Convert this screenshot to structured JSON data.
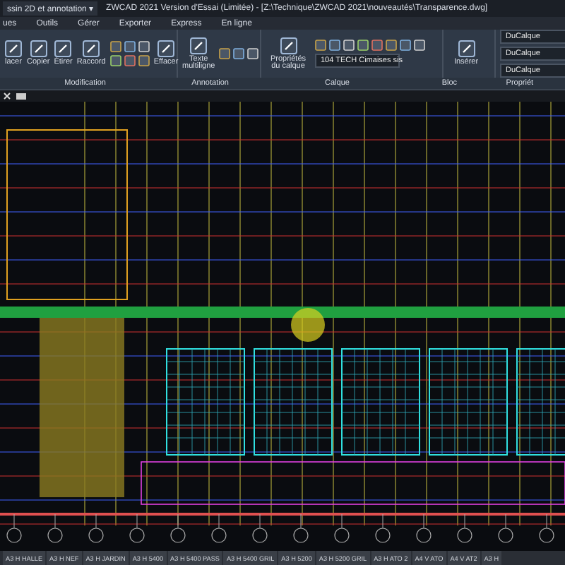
{
  "window": {
    "workspace": "ssin 2D et annotation",
    "workspace_caret": "▾",
    "title": "ZWCAD 2021 Version d'Essai (Limitée) - [Z:\\Technique\\ZWCAD 2021\\nouveautés\\Transparence.dwg]"
  },
  "menu": [
    {
      "label": "ues",
      "selected": false
    },
    {
      "label": "Outils",
      "selected": false
    },
    {
      "label": "Gérer",
      "selected": false
    },
    {
      "label": "Exporter",
      "selected": false
    },
    {
      "label": "Express",
      "selected": false
    },
    {
      "label": "En ligne",
      "selected": false
    }
  ],
  "ribbon": {
    "panels": [
      {
        "label": "Modification",
        "buttons": [
          {
            "label": "lacer"
          },
          {
            "label": "Copier"
          },
          {
            "label": "Étirer"
          },
          {
            "label": "Raccord"
          },
          {
            "label": "Effacer"
          }
        ]
      },
      {
        "label": "Annotation",
        "buttons": [
          {
            "label": "Texte multiligne"
          }
        ]
      },
      {
        "label": "Calque",
        "buttons": [
          {
            "label": "Propriétés du calque"
          }
        ],
        "layer": "104 TECH Cimaises sis"
      },
      {
        "label": "Bloc",
        "buttons": [
          {
            "label": "Insérer"
          }
        ]
      },
      {
        "label": "Propriét",
        "dropdowns": [
          "DuCalque",
          "DuCalque",
          "DuCalque"
        ]
      }
    ]
  },
  "layout_tabs": [
    {
      "label": "A3 H HALLE",
      "selected": false
    },
    {
      "label": "A3 H NEF",
      "selected": false
    },
    {
      "label": "A3 H JARDIN",
      "selected": false
    },
    {
      "label": "A3 H 5400",
      "selected": false
    },
    {
      "label": "A3 H 5400 PASS",
      "selected": false
    },
    {
      "label": "A3 H 5400 GRIL",
      "selected": false
    },
    {
      "label": "A3 H 5200",
      "selected": false
    },
    {
      "label": "A3 H 5200 GRIL",
      "selected": false
    },
    {
      "label": "A3 H ATO 2",
      "selected": false
    },
    {
      "label": "A4 V ATO",
      "selected": false
    },
    {
      "label": "A4 V AT2",
      "selected": false
    },
    {
      "label": "A3 H",
      "selected": false
    }
  ]
}
